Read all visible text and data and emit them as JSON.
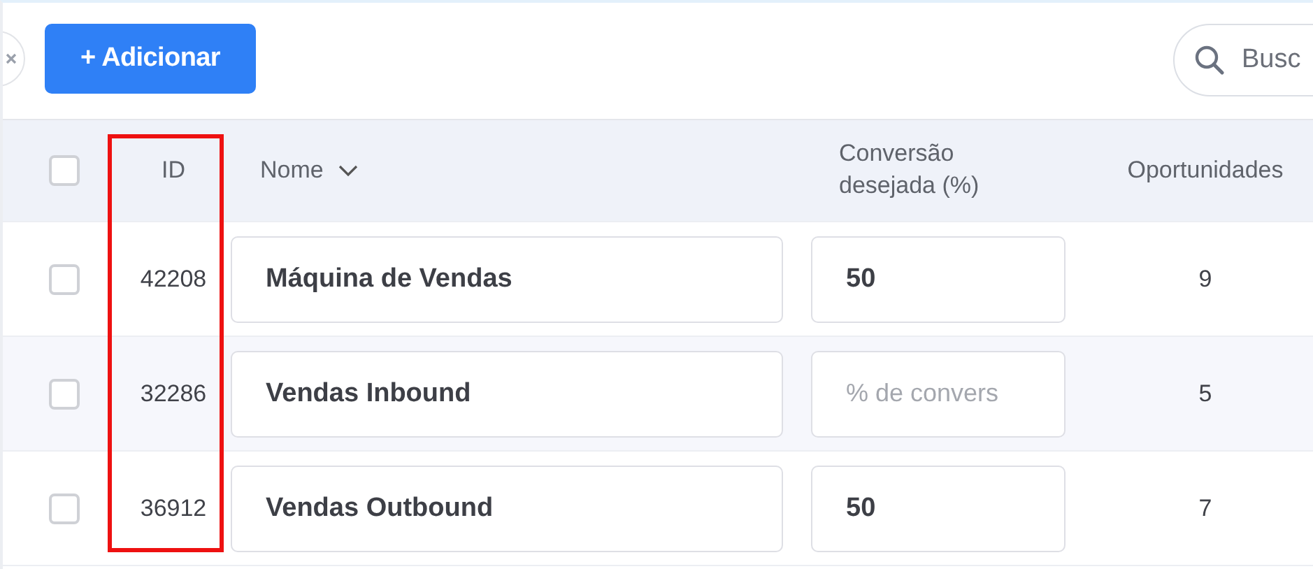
{
  "toolbar": {
    "add_button": "+ Adicionar",
    "search": {
      "placeholder": "Busc"
    }
  },
  "table": {
    "select_all": {
      "checked": false
    },
    "columns": [
      {
        "label": "ID",
        "highlighted": true,
        "kind": "plain"
      },
      {
        "label": "Nome",
        "highlighted": false,
        "kind": "sortable"
      },
      {
        "label": "Conversão desejada (%)",
        "highlighted": false,
        "kind": "plain"
      },
      {
        "label": "Oportunidades",
        "highlighted": false,
        "kind": "plain"
      }
    ],
    "rows": [
      {
        "checked": false,
        "id": "42208",
        "name": "Máquina de Vendas",
        "conversion": "50",
        "opportunities": "9"
      },
      {
        "checked": false,
        "id": "32286",
        "name": "Vendas Inbound",
        "conversion_placeholder": "% de convers",
        "opportunities": "5"
      },
      {
        "checked": false,
        "id": "36912",
        "name": "Vendas Outbound",
        "conversion": "50",
        "opportunities": "7"
      }
    ]
  }
}
